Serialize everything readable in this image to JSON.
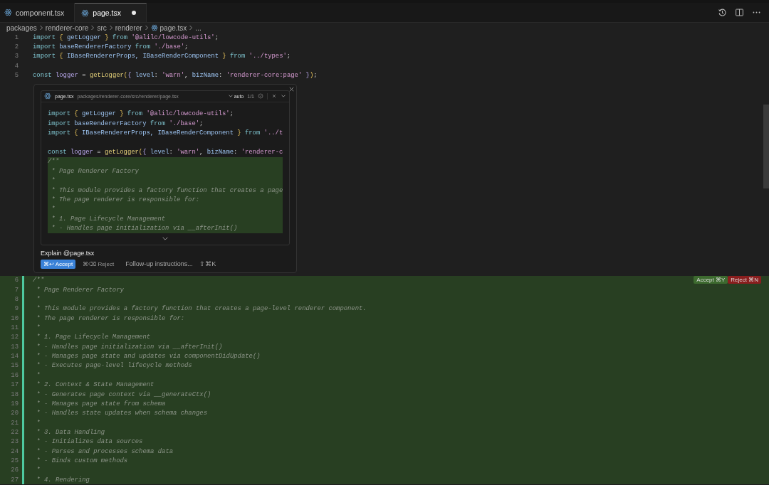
{
  "tabs": [
    {
      "label": "component.tsx",
      "selected": false,
      "modified": false
    },
    {
      "label": "page.tsx",
      "selected": true,
      "modified": true
    }
  ],
  "breadcrumb": [
    {
      "label": "packages",
      "kind": "folder"
    },
    {
      "label": "renderer-core",
      "kind": "folder"
    },
    {
      "label": "src",
      "kind": "folder"
    },
    {
      "label": "renderer",
      "kind": "folder"
    },
    {
      "label": "page.tsx",
      "kind": "file"
    },
    {
      "label": "...",
      "kind": "folder"
    }
  ],
  "editor": {
    "top_lines": [
      {
        "number": "1",
        "added": false,
        "tokens": [
          {
            "t": "import ",
            "kind": "keyword"
          },
          {
            "t": "{",
            "kind": "brace"
          },
          {
            "t": " getLogger ",
            "kind": "identifier"
          },
          {
            "t": "}",
            "kind": "brace"
          },
          {
            "t": " from ",
            "kind": "keyword"
          },
          {
            "t": "'@alilc/lowcode-utils'",
            "kind": "string"
          },
          {
            "t": ";",
            "kind": "plain"
          }
        ]
      },
      {
        "number": "2",
        "added": false,
        "tokens": [
          {
            "t": "import",
            "kind": "keyword"
          },
          {
            "t": " baseRendererFactory ",
            "kind": "identifier"
          },
          {
            "t": "from ",
            "kind": "keyword"
          },
          {
            "t": "'./base'",
            "kind": "string"
          },
          {
            "t": ";",
            "kind": "plain"
          }
        ]
      },
      {
        "number": "3",
        "added": false,
        "tokens": [
          {
            "t": "import ",
            "kind": "keyword"
          },
          {
            "t": "{",
            "kind": "brace"
          },
          {
            "t": " IBaseRendererProps, IBaseRenderComponent ",
            "kind": "identifier"
          },
          {
            "t": "}",
            "kind": "brace"
          },
          {
            "t": " from ",
            "kind": "keyword"
          },
          {
            "t": "'../types'",
            "kind": "string"
          },
          {
            "t": ";",
            "kind": "plain"
          }
        ]
      },
      {
        "number": "4",
        "added": false
      },
      {
        "number": "5",
        "added": false,
        "tokens": [
          {
            "t": "const ",
            "kind": "keyword"
          },
          {
            "t": "logger",
            "kind": "variable"
          },
          {
            "t": " = ",
            "kind": "plain"
          },
          {
            "t": "getLogger",
            "kind": "function"
          },
          {
            "t": "(",
            "kind": "brace"
          },
          {
            "t": "{ ",
            "kind": "variable"
          },
          {
            "t": "level",
            "kind": "identifier"
          },
          {
            "t": ": ",
            "kind": "plain"
          },
          {
            "t": "'warn'",
            "kind": "string"
          },
          {
            "t": ", ",
            "kind": "plain"
          },
          {
            "t": "bizName",
            "kind": "identifier"
          },
          {
            "t": ": ",
            "kind": "plain"
          },
          {
            "t": "'renderer-core:page'",
            "kind": "string"
          },
          {
            "t": " }",
            "kind": "variable"
          },
          {
            "t": ")",
            "kind": "brace"
          },
          {
            "t": ";",
            "kind": "plain"
          }
        ]
      }
    ],
    "diff_actions": {
      "accept": "Accept ⌘Y",
      "reject": "Reject ⌘N"
    },
    "bottom_lines": [
      {
        "number": "6",
        "added": true,
        "tokens": [
          {
            "t": "/**",
            "kind": "comment"
          }
        ]
      },
      {
        "number": "7",
        "added": true,
        "tokens": [
          {
            "t": " * Page Renderer Factory",
            "kind": "comment"
          }
        ]
      },
      {
        "number": "8",
        "added": true,
        "tokens": [
          {
            "t": " *",
            "kind": "comment"
          }
        ]
      },
      {
        "number": "9",
        "added": true,
        "tokens": [
          {
            "t": " * This module provides a factory function that creates a page-level renderer component.",
            "kind": "comment"
          }
        ]
      },
      {
        "number": "10",
        "added": true,
        "tokens": [
          {
            "t": " * The page renderer is responsible for:",
            "kind": "comment"
          }
        ]
      },
      {
        "number": "11",
        "added": true,
        "tokens": [
          {
            "t": " *",
            "kind": "comment"
          }
        ]
      },
      {
        "number": "12",
        "added": true,
        "tokens": [
          {
            "t": " * 1. Page Lifecycle Management",
            "kind": "comment"
          }
        ]
      },
      {
        "number": "13",
        "added": true,
        "tokens": [
          {
            "t": " * - Handles page initialization via __afterInit()",
            "kind": "comment"
          }
        ]
      },
      {
        "number": "14",
        "added": true,
        "tokens": [
          {
            "t": " * - Manages page state and updates via componentDidUpdate()",
            "kind": "comment"
          }
        ]
      },
      {
        "number": "15",
        "added": true,
        "tokens": [
          {
            "t": " * - Executes page-level lifecycle methods",
            "kind": "comment"
          }
        ]
      },
      {
        "number": "16",
        "added": true,
        "tokens": [
          {
            "t": " *",
            "kind": "comment"
          }
        ]
      },
      {
        "number": "17",
        "added": true,
        "tokens": [
          {
            "t": " * 2. Context & State Management",
            "kind": "comment"
          }
        ]
      },
      {
        "number": "18",
        "added": true,
        "tokens": [
          {
            "t": " * - Generates page context via __generateCtx()",
            "kind": "comment"
          }
        ]
      },
      {
        "number": "19",
        "added": true,
        "tokens": [
          {
            "t": " * - Manages page state from schema",
            "kind": "comment"
          }
        ]
      },
      {
        "number": "20",
        "added": true,
        "tokens": [
          {
            "t": " * - Handles state updates when schema changes",
            "kind": "comment"
          }
        ]
      },
      {
        "number": "21",
        "added": true,
        "tokens": [
          {
            "t": " *",
            "kind": "comment"
          }
        ]
      },
      {
        "number": "22",
        "added": true,
        "tokens": [
          {
            "t": " * 3. Data Handling",
            "kind": "comment"
          }
        ]
      },
      {
        "number": "23",
        "added": true,
        "tokens": [
          {
            "t": " * - Initializes data sources",
            "kind": "comment"
          }
        ]
      },
      {
        "number": "24",
        "added": true,
        "tokens": [
          {
            "t": " * - Parses and processes schema data",
            "kind": "comment"
          }
        ]
      },
      {
        "number": "25",
        "added": true,
        "tokens": [
          {
            "t": " * - Binds custom methods",
            "kind": "comment"
          }
        ]
      },
      {
        "number": "26",
        "added": true,
        "tokens": [
          {
            "t": " *",
            "kind": "comment"
          }
        ]
      },
      {
        "number": "27",
        "added": true,
        "tokens": [
          {
            "t": " * 4. Rendering",
            "kind": "comment"
          }
        ]
      }
    ]
  },
  "inline_edit": {
    "file": "page.tsx",
    "path": "packages/renderer-core/src/renderer/page.tsx",
    "model": "auto",
    "count": "1/1",
    "preview_lines": [
      {
        "added": false,
        "tokens": [
          {
            "t": "import ",
            "kind": "keyword"
          },
          {
            "t": "{",
            "kind": "brace"
          },
          {
            "t": " getLogger ",
            "kind": "identifier"
          },
          {
            "t": "}",
            "kind": "brace"
          },
          {
            "t": " from ",
            "kind": "keyword"
          },
          {
            "t": "'@alilc/lowcode-utils'",
            "kind": "string"
          },
          {
            "t": ";",
            "kind": "plain"
          }
        ]
      },
      {
        "added": false,
        "tokens": [
          {
            "t": "import",
            "kind": "keyword"
          },
          {
            "t": " baseRendererFactory ",
            "kind": "identifier"
          },
          {
            "t": "from ",
            "kind": "keyword"
          },
          {
            "t": "'./base'",
            "kind": "string"
          },
          {
            "t": ";",
            "kind": "plain"
          }
        ]
      },
      {
        "added": false,
        "tokens": [
          {
            "t": "import ",
            "kind": "keyword"
          },
          {
            "t": "{",
            "kind": "brace"
          },
          {
            "t": " IBaseRendererProps, IBaseRenderComponent ",
            "kind": "identifier"
          },
          {
            "t": "}",
            "kind": "brace"
          },
          {
            "t": " from ",
            "kind": "keyword"
          },
          {
            "t": "'../t",
            "kind": "string"
          }
        ]
      },
      {
        "added": false
      },
      {
        "added": false,
        "tokens": [
          {
            "t": "const ",
            "kind": "keyword"
          },
          {
            "t": "logger",
            "kind": "variable"
          },
          {
            "t": " = ",
            "kind": "plain"
          },
          {
            "t": "getLogger",
            "kind": "function"
          },
          {
            "t": "(",
            "kind": "brace"
          },
          {
            "t": "{ ",
            "kind": "variable"
          },
          {
            "t": "level",
            "kind": "identifier"
          },
          {
            "t": ": ",
            "kind": "plain"
          },
          {
            "t": "'warn'",
            "kind": "string"
          },
          {
            "t": ", ",
            "kind": "plain"
          },
          {
            "t": "bizName",
            "kind": "identifier"
          },
          {
            "t": ": ",
            "kind": "plain"
          },
          {
            "t": "'renderer-c",
            "kind": "string"
          }
        ]
      },
      {
        "added": true,
        "tokens": [
          {
            "t": "/**",
            "kind": "comment"
          }
        ]
      },
      {
        "added": true,
        "tokens": [
          {
            "t": " * Page Renderer Factory",
            "kind": "comment"
          }
        ]
      },
      {
        "added": true,
        "tokens": [
          {
            "t": " *",
            "kind": "comment"
          }
        ]
      },
      {
        "added": true,
        "tokens": [
          {
            "t": " * This module provides a factory function that creates a page",
            "kind": "comment"
          }
        ]
      },
      {
        "added": true,
        "tokens": [
          {
            "t": " * The page renderer is responsible for:",
            "kind": "comment"
          }
        ]
      },
      {
        "added": true,
        "tokens": [
          {
            "t": " *",
            "kind": "comment"
          }
        ]
      },
      {
        "added": true,
        "tokens": [
          {
            "t": " * 1. Page Lifecycle Management",
            "kind": "comment"
          }
        ]
      },
      {
        "added": true,
        "tokens": [
          {
            "t": " * - Handles page initialization via __afterInit()",
            "kind": "comment"
          }
        ]
      }
    ],
    "prompt": "Explain @page.tsx",
    "accept": "⌘↩ Accept",
    "reject": "⌘⌫ Reject",
    "followup_placeholder": "Follow-up instructions...",
    "followup_shortcut": "⇧⌘K"
  }
}
